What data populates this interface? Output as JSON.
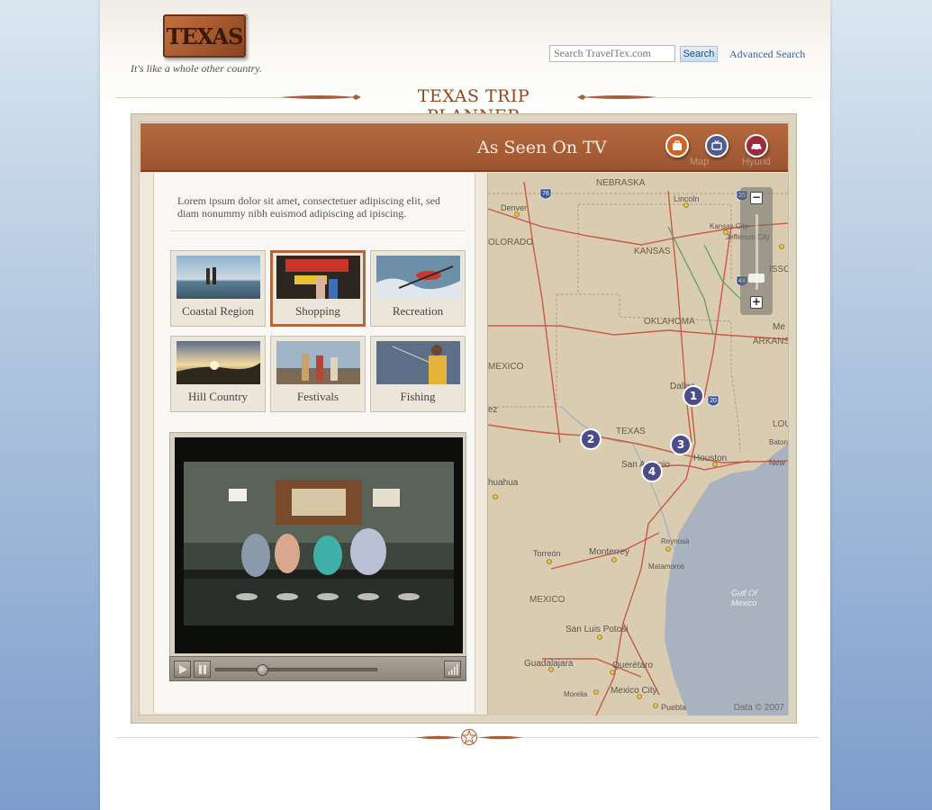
{
  "header": {
    "logo_text": "TEXAS",
    "logo_reg": "®",
    "tagline": "It's like a whole other country."
  },
  "search": {
    "placeholder": "Search TravelTex.com",
    "button_label": "Search",
    "advanced_label": "Advanced Search"
  },
  "planner": {
    "title": "TEXAS TRIP PLANNER",
    "section_title": "As Seen On TV",
    "header_icons": [
      "briefcase-icon",
      "tv-icon",
      "car-icon"
    ],
    "maptype_labels": [
      "Map",
      "Hybrid"
    ],
    "intro_text": "Lorem ipsum dolor sit amet, consectetuer adipiscing elit, sed diam nonummy nibh euismod adipiscing ad ipiscing.",
    "categories": [
      {
        "label": "Coastal Region",
        "selected": false
      },
      {
        "label": "Shopping",
        "selected": true
      },
      {
        "label": "Recreation",
        "selected": false
      },
      {
        "label": "Hill Country",
        "selected": false
      },
      {
        "label": "Festivals",
        "selected": false
      },
      {
        "label": "Fishing",
        "selected": false
      }
    ],
    "video": {
      "progress": 0.27
    }
  },
  "map": {
    "zoom_in": "+",
    "zoom_out": "−",
    "copyright": "Data  ©  2007",
    "labels": {
      "nebraska": "NEBRASKA",
      "denver": "Denver",
      "colorado": "OLORADO",
      "kansas": "KANSAS",
      "lincoln": "Lincoln",
      "kansas_city": "Kansas City",
      "jefferson_city": "Jefferson City",
      "missouri": "ISSO",
      "oklahoma": "OKLAHOMA",
      "arkans": "ARKANS",
      "me": "Me",
      "mexico_nm": "MEXICO",
      "dallas": "Dallas",
      "ez": "ez",
      "texas": "TEXAS",
      "louisiana": "LOUISIAI",
      "baton_rouge": "Baton Rouge",
      "new": "New",
      "houston": "Houston",
      "san_antonio": "San Antonio",
      "chihuahua": "huahua",
      "reynosa": "Reynosa",
      "matamoros": "Matamoros",
      "torreon": "Torreón",
      "monterrey": "Monterrey",
      "mexico": "MEXICO",
      "gulf": "Gulf Of",
      "gulf2": "Mexico",
      "san_luis": "San Luis Potosi",
      "guadalajara": "Guadalajara",
      "queretaro": "Querétaro",
      "morelia": "Morelia",
      "mexico_city": "Mexico City",
      "puebla": "Puebla",
      "i76": "76",
      "i29": "35",
      "i20": "20",
      "i44": "44"
    },
    "markers": [
      "1",
      "2",
      "3",
      "4"
    ]
  }
}
